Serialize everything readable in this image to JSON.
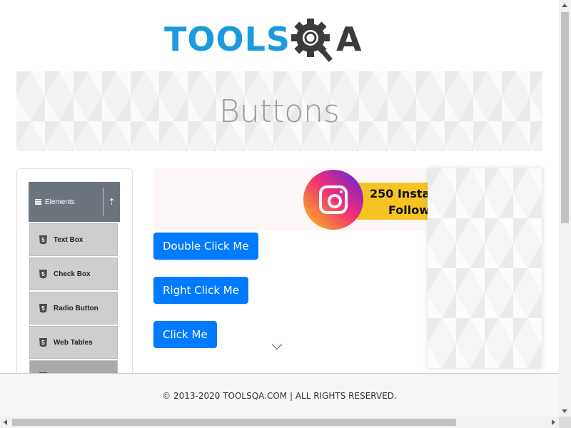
{
  "header": {
    "logo_text": "TOOLS",
    "logo_tail": "A",
    "logo_color": "#1a9be0"
  },
  "page": {
    "title": "Buttons"
  },
  "sidebar": {
    "group": {
      "icon": "menu-icon",
      "title": "Elements",
      "toggle_icon": "arrow-up-icon",
      "toggle_glyph": "⇡"
    },
    "items": [
      {
        "icon": "html5-icon",
        "icon_glyph": "5",
        "label": "Text Box"
      },
      {
        "icon": "html5-icon",
        "icon_glyph": "5",
        "label": "Check Box"
      },
      {
        "icon": "html5-icon",
        "icon_glyph": "5",
        "label": "Radio Button"
      },
      {
        "icon": "html5-icon",
        "icon_glyph": "5",
        "label": "Web Tables"
      },
      {
        "icon": "html5-icon",
        "icon_glyph": "",
        "label": ""
      }
    ]
  },
  "ad": {
    "icon": "instagram-icon",
    "line1": "250 Insta",
    "line2": "Follow"
  },
  "buttons": {
    "double_click": "Double Click Me",
    "right_click": "Right Click Me",
    "click": "Click Me",
    "color": "#007bff"
  },
  "footer": {
    "text": "© 2013-2020 TOOLSQA.COM | ALL RIGHTS RESERVED."
  }
}
